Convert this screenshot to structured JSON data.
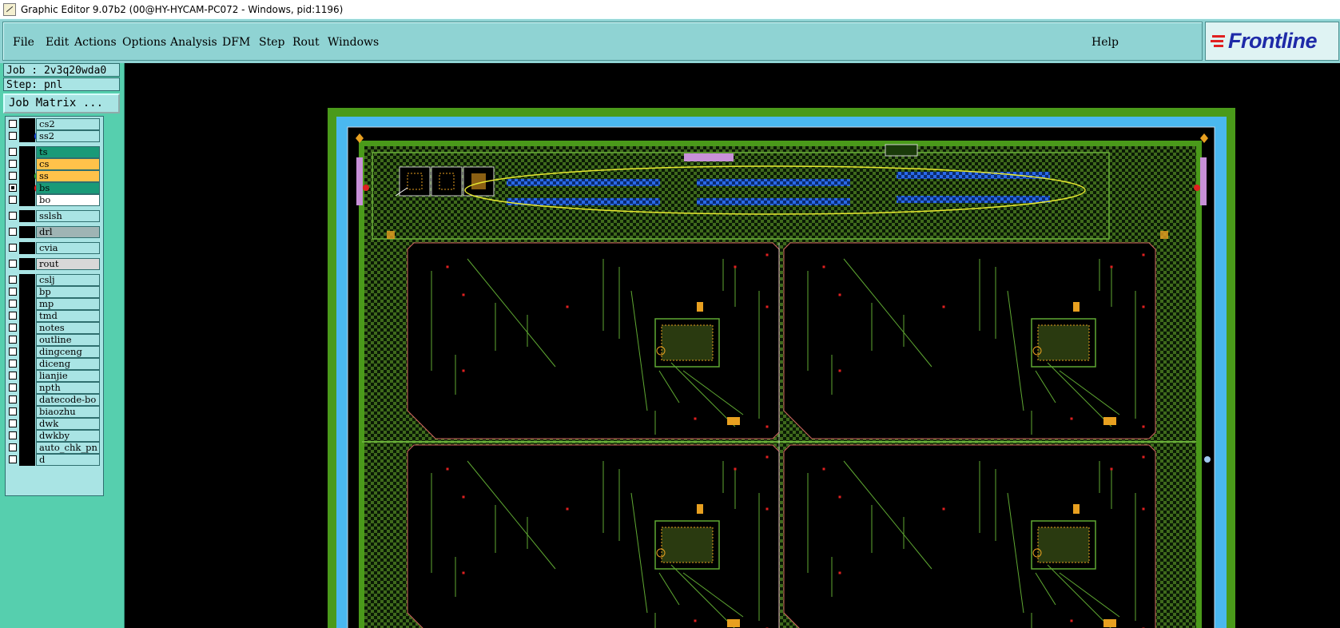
{
  "window": {
    "title": "Graphic Editor 9.07b2 (00@HY-HYCAM-PC072 - Windows, pid:1196)"
  },
  "menu": {
    "items": [
      "File",
      "Edit",
      "Actions",
      "Options",
      "Analysis",
      "DFM",
      "Step",
      "Rout",
      "Windows"
    ],
    "help": "Help"
  },
  "logo": {
    "text": "Frontline"
  },
  "job": {
    "job_label": "Job : 2v3q20wda0",
    "step_label": "Step: pnl",
    "matrix_button": "Job Matrix ..."
  },
  "layers": [
    {
      "name": "cs2",
      "color": "#a9e4e4",
      "dot": ""
    },
    {
      "name": "ss2",
      "color": "#a9e4e4",
      "dot": "#1f4fe0"
    },
    {
      "name": "ts",
      "color": "#1a9a78",
      "dot": ""
    },
    {
      "name": "cs",
      "color": "#ffc24a",
      "dot": ""
    },
    {
      "name": "ss",
      "color": "#ffc24a",
      "dot": "#3bb13b"
    },
    {
      "name": "bs",
      "color": "#1a9a78",
      "dot": "#ee1c1c",
      "active": true
    },
    {
      "name": "bo",
      "color": "#ffffff",
      "dot": ""
    },
    {
      "name": "sslsh",
      "color": "#a9e4e4",
      "dot": ""
    },
    {
      "name": "drl",
      "color": "#9fb4b4",
      "dot": ""
    },
    {
      "name": "cvia",
      "color": "#a9e4e4",
      "dot": ""
    },
    {
      "name": "rout",
      "color": "#d8d8d8",
      "dot": ""
    },
    {
      "name": "cslj",
      "color": "#a9e4e4",
      "dot": ""
    },
    {
      "name": "bp",
      "color": "#a9e4e4",
      "dot": ""
    },
    {
      "name": "mp",
      "color": "#a9e4e4",
      "dot": ""
    },
    {
      "name": "tmd",
      "color": "#a9e4e4",
      "dot": ""
    },
    {
      "name": "notes",
      "color": "#a9e4e4",
      "dot": ""
    },
    {
      "name": "outline",
      "color": "#a9e4e4",
      "dot": ""
    },
    {
      "name": "dingceng",
      "color": "#a9e4e4",
      "dot": ""
    },
    {
      "name": "diceng",
      "color": "#a9e4e4",
      "dot": ""
    },
    {
      "name": "lianjie",
      "color": "#a9e4e4",
      "dot": ""
    },
    {
      "name": "npth",
      "color": "#a9e4e4",
      "dot": ""
    },
    {
      "name": "datecode-bo",
      "color": "#a9e4e4",
      "dot": ""
    },
    {
      "name": "biaozhu",
      "color": "#a9e4e4",
      "dot": ""
    },
    {
      "name": "dwk",
      "color": "#a9e4e4",
      "dot": ""
    },
    {
      "name": "dwkby",
      "color": "#a9e4e4",
      "dot": ""
    },
    {
      "name": "auto_chk_pn",
      "color": "#a9e4e4",
      "dot": ""
    },
    {
      "name": "d",
      "color": "#a9e4e4",
      "dot": ""
    }
  ],
  "colors": {
    "menu_bg": "#8fd3d3",
    "panel_bg": "#56cfae",
    "board_frame": "#4a9a1a",
    "board_border": "#4ab8f0",
    "copper_hatch": "#3f6a1c",
    "trace": "#5fa832",
    "selection_ellipse": "#e8e830",
    "pad_blue": "#1f5fd8",
    "pad_orange": "#e8a020",
    "drill_red": "#e02020"
  }
}
